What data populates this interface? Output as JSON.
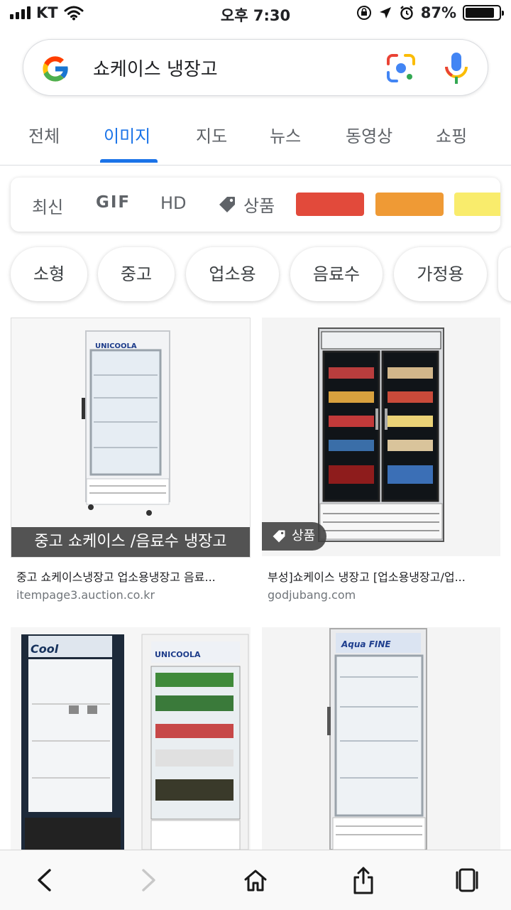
{
  "status_bar": {
    "carrier": "KT",
    "time": "오후 7:30",
    "battery": "87%",
    "battery_level": 0.87,
    "icons": [
      "signal-icon",
      "wifi-icon",
      "orientation-lock-icon",
      "location-icon",
      "alarm-icon",
      "battery-icon"
    ]
  },
  "search": {
    "query": "쇼케이스 냉장고",
    "icons": [
      "google-logo-icon",
      "google-lens-icon",
      "microphone-icon"
    ]
  },
  "tabs": [
    {
      "label": "전체",
      "active": false
    },
    {
      "label": "이미지",
      "active": true
    },
    {
      "label": "지도",
      "active": false
    },
    {
      "label": "뉴스",
      "active": false
    },
    {
      "label": "동영상",
      "active": false
    },
    {
      "label": "쇼핑",
      "active": false
    }
  ],
  "filters": {
    "recent": "최신",
    "gif": "GIF",
    "hd": "HD",
    "product": "상품",
    "colors": [
      "#e24a3b",
      "#ef9a35",
      "#f9ec6c"
    ]
  },
  "chips": [
    "소형",
    "중고",
    "업소용",
    "음료수",
    "가정용"
  ],
  "results": [
    {
      "overlay": "중고 쇼케이스 /음료수 냉장고",
      "title": "중고 쇼케이스냉장고 업소용냉장고 음료...",
      "source": "itempage3.auction.co.kr",
      "brand": "UNICOOLA"
    },
    {
      "badge": "상품",
      "title": "부성]쇼케이스 냉장고 [업소용냉장고/업...",
      "source": "godjubang.com"
    },
    {
      "brand_left": "Cool",
      "brand_right": "UNICOOLA"
    },
    {
      "brand": "Aqua FINE"
    }
  ],
  "toolbar": {
    "icons": [
      "back-icon",
      "forward-icon",
      "home-icon",
      "share-icon",
      "tabs-icon"
    ]
  }
}
